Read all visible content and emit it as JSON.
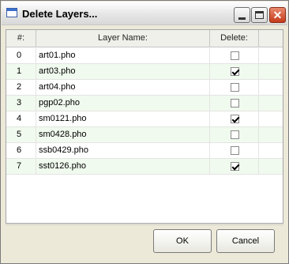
{
  "window": {
    "title": "Delete Layers..."
  },
  "table": {
    "headers": {
      "number": "#:",
      "layer_name": "Layer Name:",
      "delete": "Delete:"
    },
    "rows": [
      {
        "num": "0",
        "name": "art01.pho",
        "delete": false
      },
      {
        "num": "1",
        "name": "art03.pho",
        "delete": true
      },
      {
        "num": "2",
        "name": "art04.pho",
        "delete": false
      },
      {
        "num": "3",
        "name": "pgp02.pho",
        "delete": false
      },
      {
        "num": "4",
        "name": "sm0121.pho",
        "delete": true
      },
      {
        "num": "5",
        "name": "sm0428.pho",
        "delete": false
      },
      {
        "num": "6",
        "name": "ssb0429.pho",
        "delete": false
      },
      {
        "num": "7",
        "name": "sst0126.pho",
        "delete": true
      }
    ]
  },
  "buttons": {
    "ok": "OK",
    "cancel": "Cancel"
  },
  "colors": {
    "alt_row": "#f0faee",
    "close_button": "#c63a1a"
  }
}
